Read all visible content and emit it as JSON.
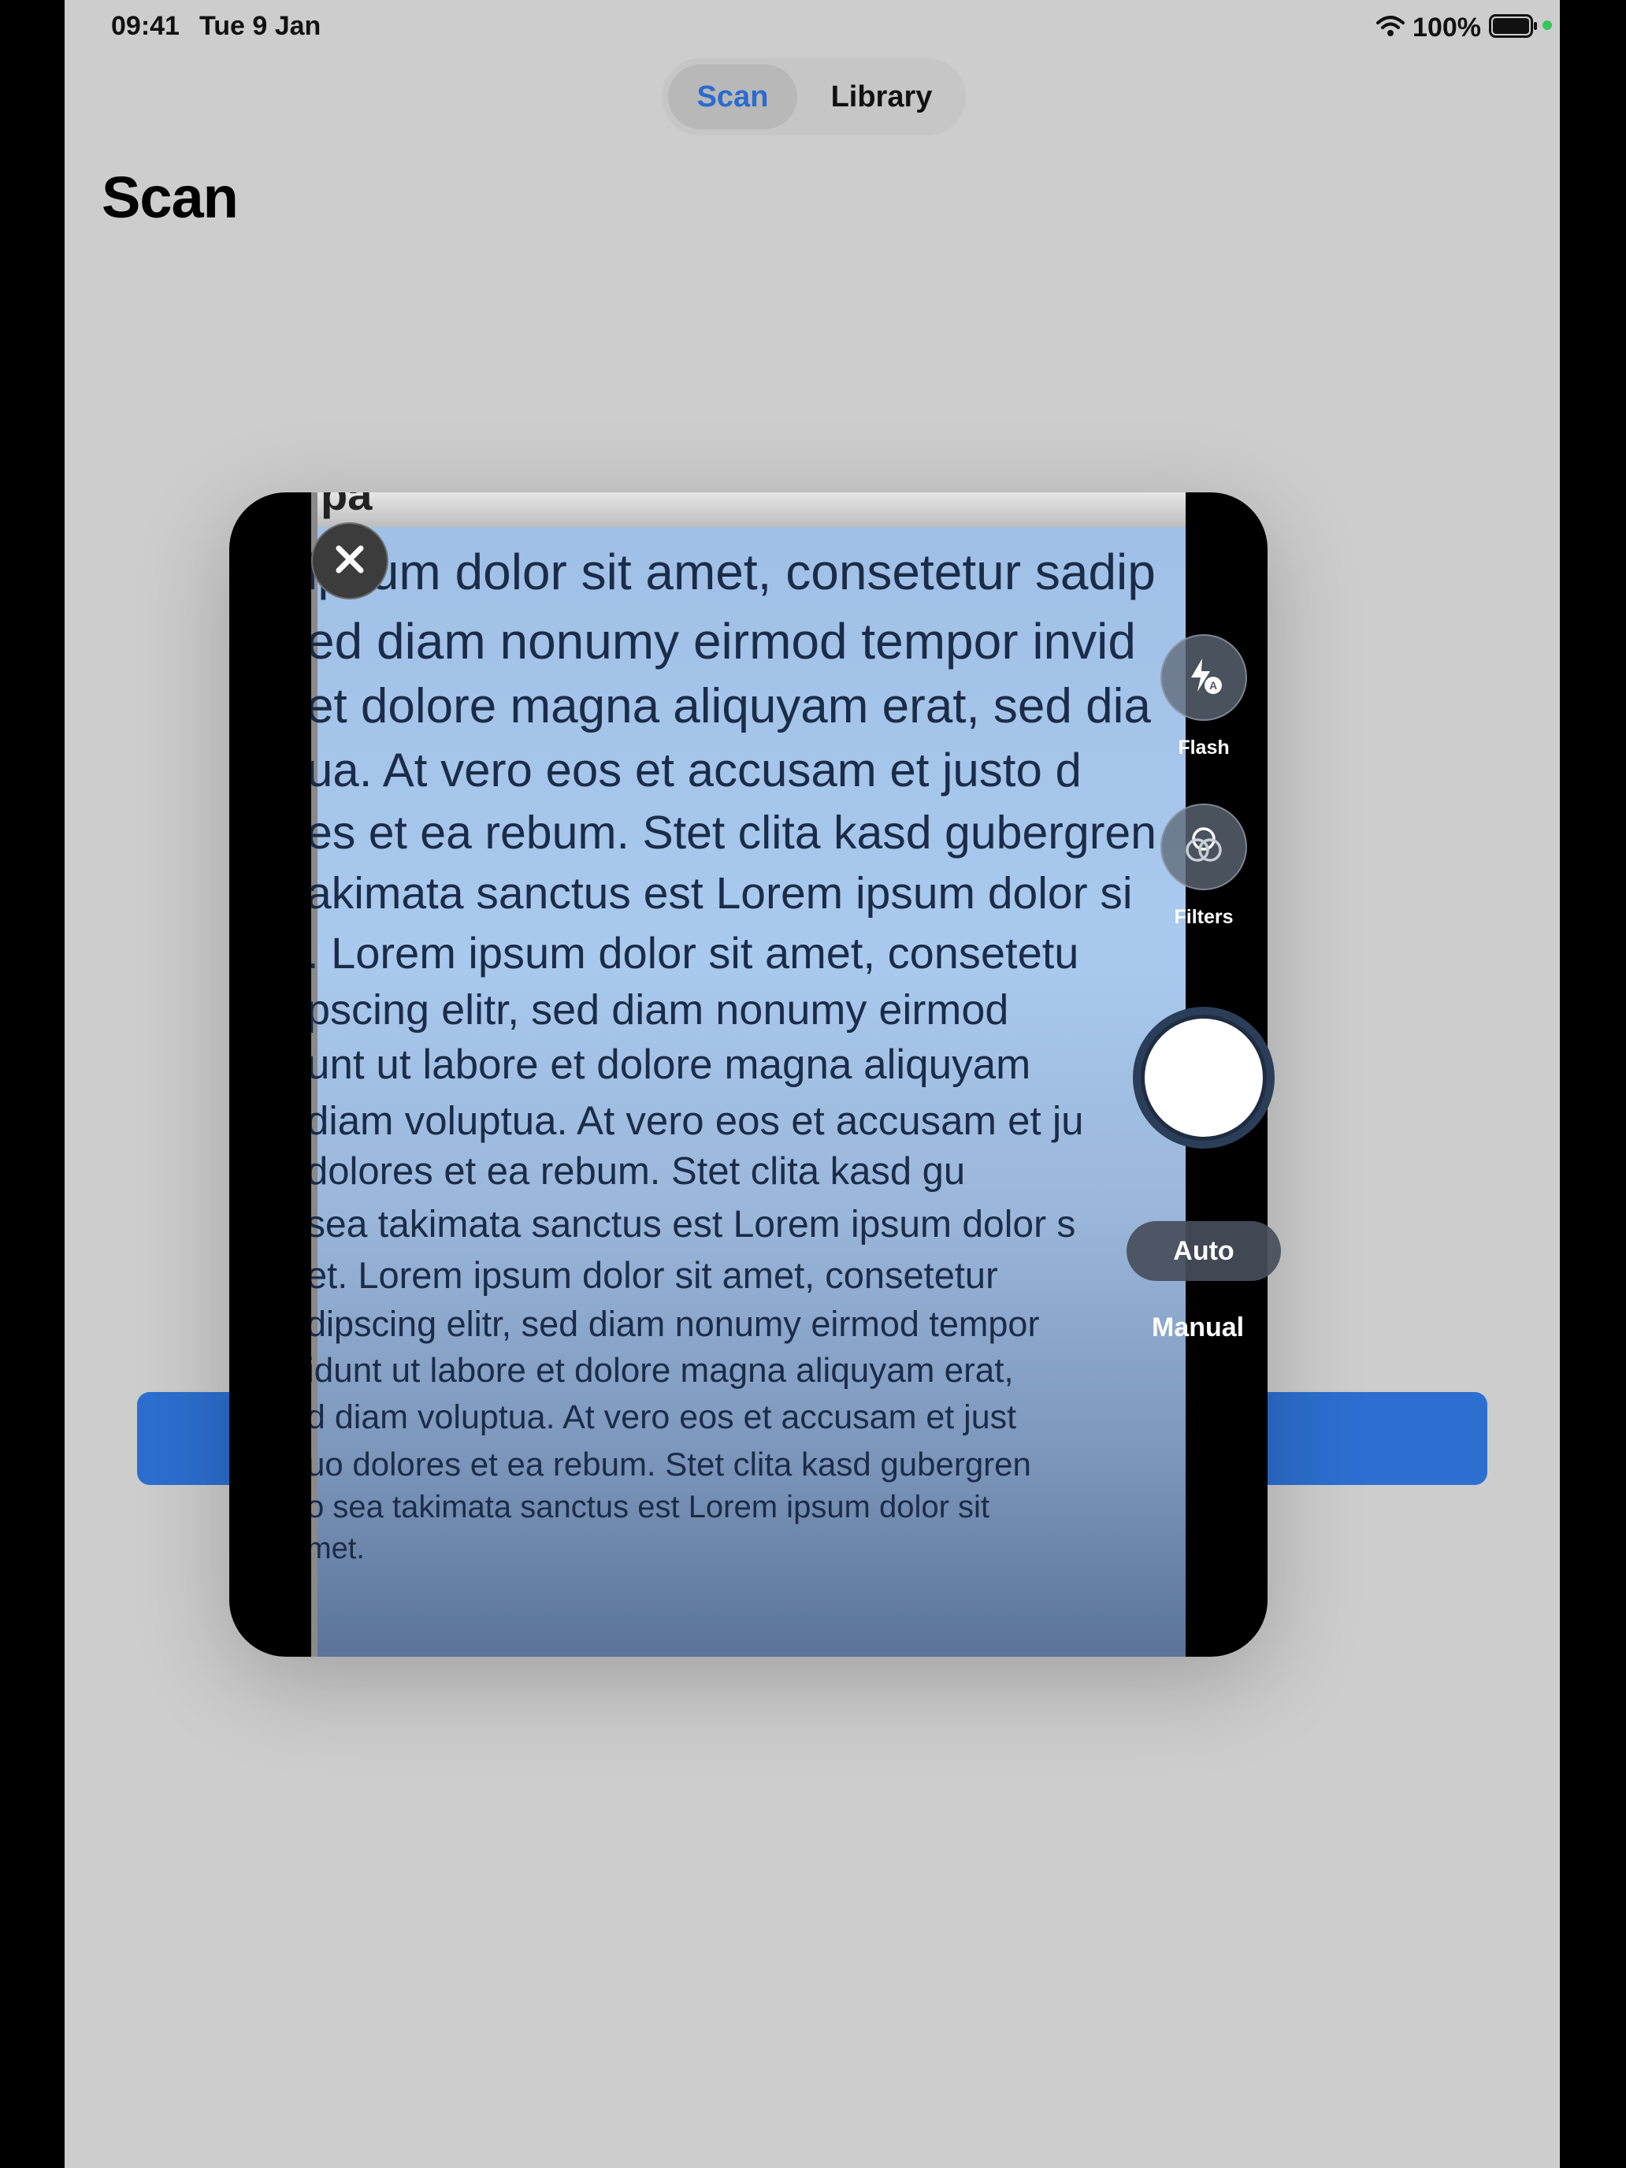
{
  "status": {
    "time": "09:41",
    "date": "Tue 9 Jan",
    "battery": "100%"
  },
  "nav": {
    "segments": [
      "Scan",
      "Library"
    ],
    "selected": "Scan"
  },
  "page": {
    "title": "Scan"
  },
  "colors": {
    "accent": "#2c6fd0",
    "background": "#cdcdcd"
  },
  "camera": {
    "paper_top_text": "pa",
    "document_lines": [
      "ipsum dolor sit amet, consetetur sadip",
      "ed diam nonumy eirmod tempor invid",
      "et dolore magna aliquyam erat, sed dia",
      "ua. At vero eos et accusam et justo d",
      "es et ea rebum. Stet clita kasd gubergren",
      "akimata sanctus est Lorem ipsum dolor si",
      ". Lorem ipsum dolor sit amet, consetetu",
      "pscing elitr, sed diam nonumy eirmod",
      "unt ut labore et dolore magna aliquyam",
      "diam voluptua. At vero eos et accusam et ju",
      "dolores et ea rebum. Stet clita kasd gu",
      "sea takimata sanctus est Lorem ipsum dolor s",
      "et. Lorem ipsum dolor sit amet, consetetur",
      "dipscing elitr, sed diam nonumy eirmod tempor",
      "idunt ut labore et dolore magna aliquyam erat,",
      "d diam voluptua. At vero eos et accusam et just",
      "uo dolores et ea rebum. Stet clita kasd gubergren",
      "o sea takimata sanctus est Lorem ipsum dolor sit",
      "met."
    ],
    "flash_label": "Flash",
    "filters_label": "Filters",
    "auto_label": "Auto",
    "manual_label": "Manual",
    "icons": {
      "close": "close-icon",
      "flash": "flash-auto-icon",
      "filters": "filters-icon",
      "focus": "focus-icon"
    }
  }
}
